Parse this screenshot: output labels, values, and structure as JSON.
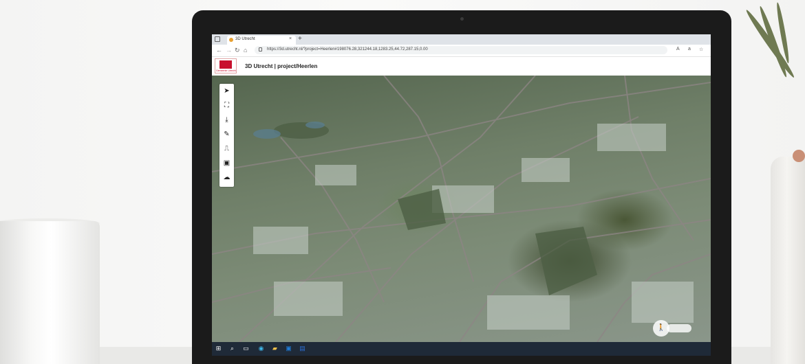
{
  "browser": {
    "tab_title": "3D Utrecht",
    "tab_close": "×",
    "new_tab": "+",
    "url": "https://3d.utrecht.nl/?project=Heerlen#198076.28,321244.18,1283.25,44.72,287.15,0.00",
    "icons": [
      "back-arrow-icon",
      "forward-arrow-icon",
      "reload-icon",
      "home-icon",
      "lock-icon",
      "read-aloud-icon",
      "font-icon",
      "favorites-icon"
    ]
  },
  "app": {
    "title": "3D Utrecht | project/Heerlen",
    "logo_text": "Gemeente Utrecht"
  },
  "toolbar": {
    "tools": [
      {
        "name": "select-tool",
        "glyph": "➤"
      },
      {
        "name": "layers-tool",
        "glyph": "⛶"
      },
      {
        "name": "download-tool",
        "glyph": "⤓"
      },
      {
        "name": "measure-tool",
        "glyph": "✎"
      },
      {
        "name": "profile-tool",
        "glyph": "⎍"
      },
      {
        "name": "screenshot-tool",
        "glyph": "▣"
      },
      {
        "name": "cloud-tool",
        "glyph": "☁"
      }
    ]
  },
  "taskbar": {
    "icons": [
      "windows-start-icon",
      "search-icon",
      "task-view-icon",
      "edge-icon",
      "file-explorer-icon",
      "outlook-icon",
      "word-icon"
    ]
  },
  "colors": {
    "accent": "#c8102e",
    "taskbar": "#1f2a38",
    "map_green": "#6f7f68"
  }
}
